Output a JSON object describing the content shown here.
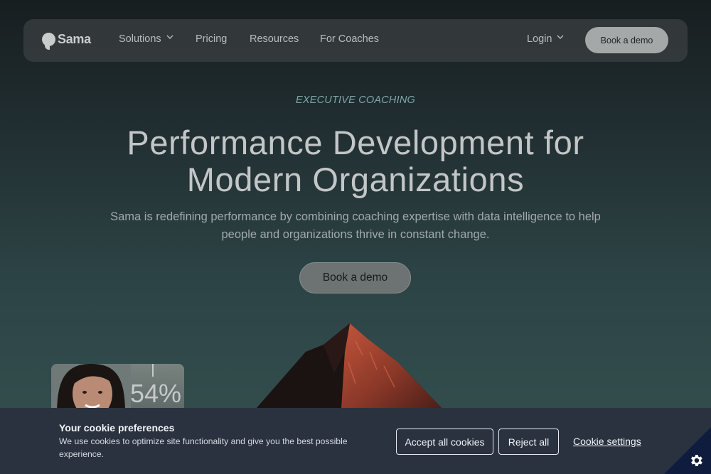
{
  "nav": {
    "logo": "Sama",
    "links": [
      {
        "label": "Solutions",
        "dropdown": true
      },
      {
        "label": "Pricing",
        "dropdown": false
      },
      {
        "label": "Resources",
        "dropdown": false
      },
      {
        "label": "For Coaches",
        "dropdown": false
      }
    ],
    "login": "Login",
    "cta": "Book a demo"
  },
  "hero": {
    "eyebrow": "EXECUTIVE COACHING",
    "headline_line1": "Performance Development for",
    "headline_line2": "Modern Organizations",
    "subhead": "Sama is redefining performance by combining coaching expertise with data intelligence to help people and organizations thrive in constant change.",
    "cta": "Book a demo"
  },
  "card": {
    "stat": "54%"
  },
  "cookie": {
    "title": "Your cookie preferences",
    "text": "We use cookies to optimize site functionality and give you the best possible experience.",
    "accept": "Accept all cookies",
    "reject": "Reject all",
    "settings": "Cookie settings"
  },
  "colors": {
    "accent_eyebrow": "#7fa6ab",
    "banner_bg": "#2a3240",
    "corner_bg": "#0f1c3d"
  },
  "icons": [
    "logo-icon",
    "chevron-down-icon",
    "gear-icon"
  ]
}
